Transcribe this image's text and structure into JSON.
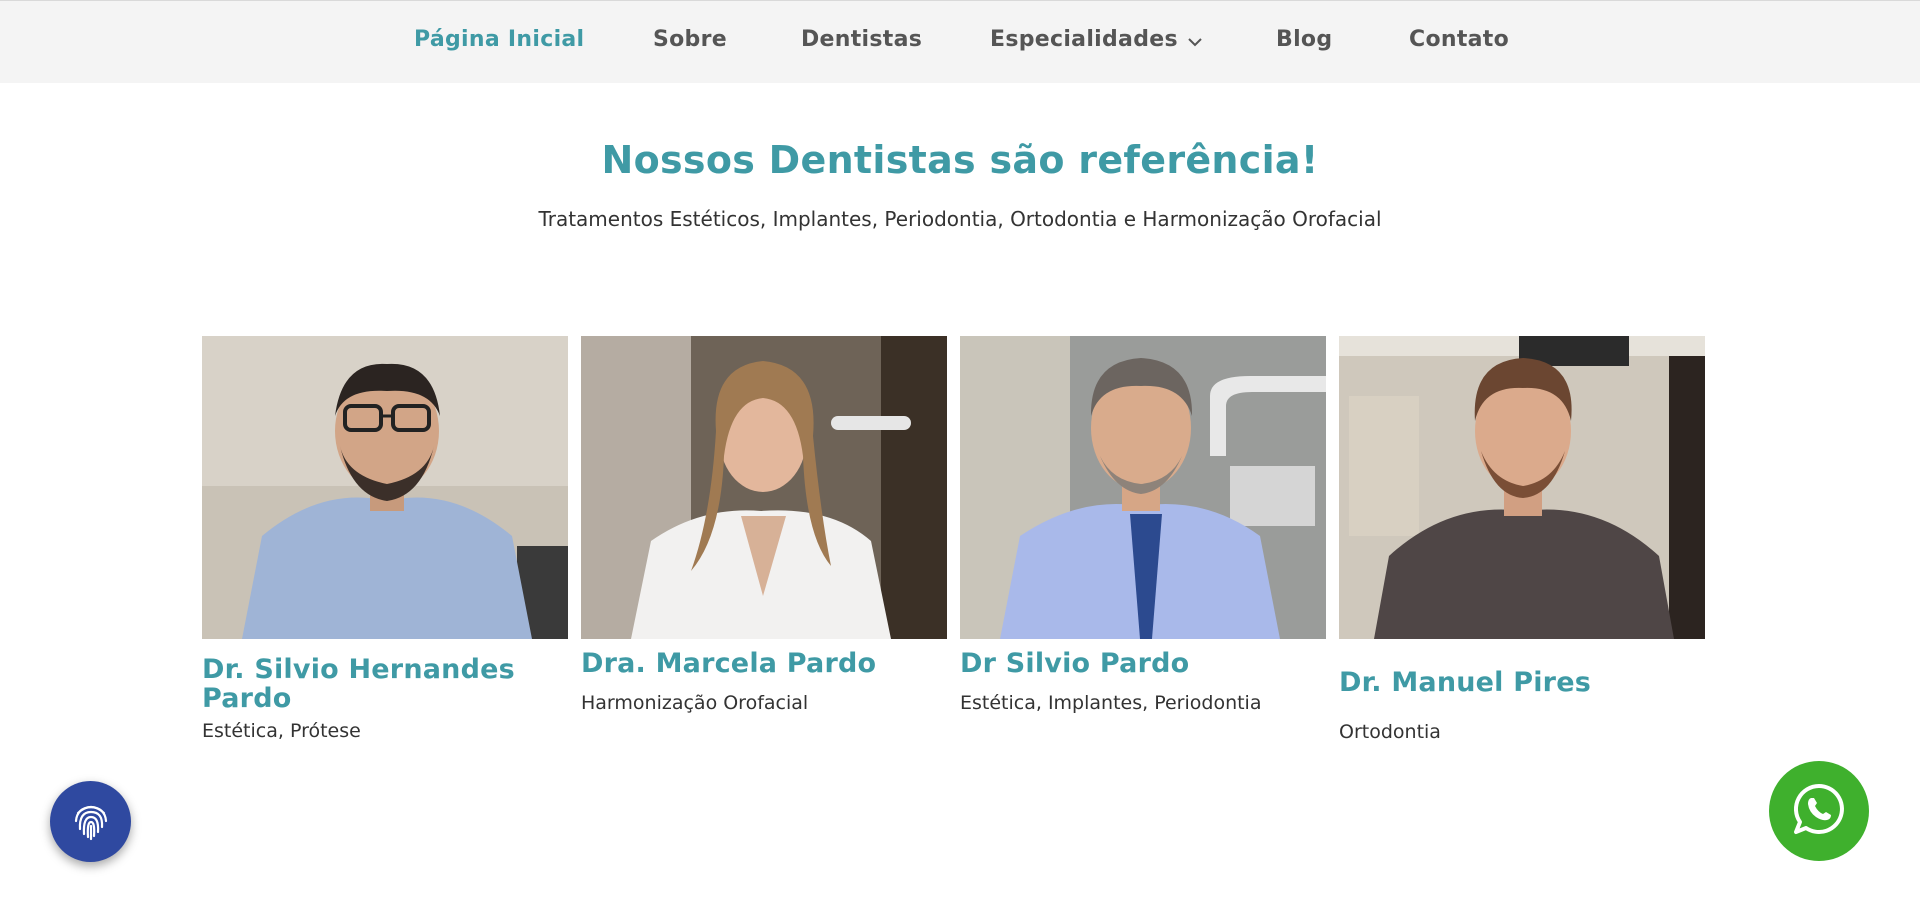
{
  "nav": {
    "items": [
      {
        "label": "Página Inicial",
        "active": true
      },
      {
        "label": "Sobre"
      },
      {
        "label": "Dentistas"
      },
      {
        "label": "Especialidades",
        "has_dropdown": true,
        "icon": "chevron-down-icon"
      },
      {
        "label": "Blog"
      },
      {
        "label": "Contato"
      }
    ]
  },
  "hero": {
    "title": "Nossos Dentistas são referência!",
    "subtitle": "Tratamentos Estéticos, Implantes, Periodontia, Ortodontia e Harmonização Orofacial"
  },
  "dentists": [
    {
      "name": "Dr. Silvio Hernandes Pardo",
      "specialty": "Estética, Prótese"
    },
    {
      "name": "Dra. Marcela Pardo",
      "specialty": "Harmonização Orofacial"
    },
    {
      "name": "Dr Silvio Pardo",
      "specialty": "Estética, Implantes, Periodontia"
    },
    {
      "name": "Dr. Manuel Pires",
      "specialty": "Ortodontia"
    }
  ],
  "floating": {
    "accessibility_icon": "fingerprint-icon",
    "whatsapp_icon": "whatsapp-icon"
  },
  "colors": {
    "accent": "#3f9aa5",
    "nav_background": "#f4f4f4",
    "whatsapp_green": "#3fb02d",
    "fingerprint_button": "#2f49a0"
  }
}
